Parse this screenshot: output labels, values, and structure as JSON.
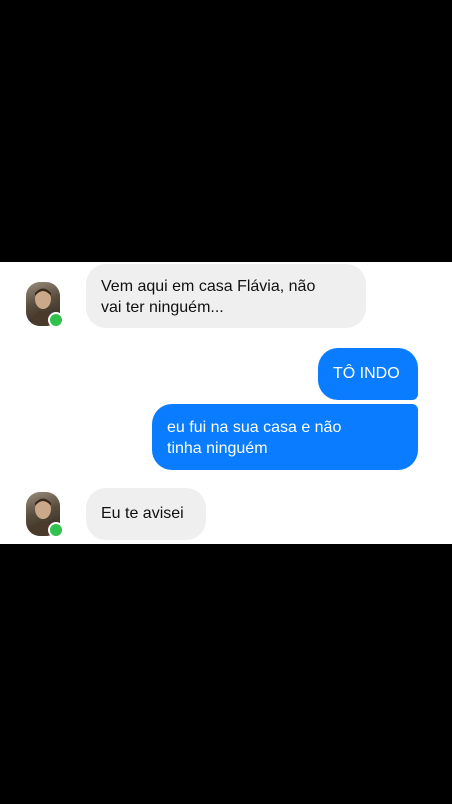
{
  "contact": {
    "avatar_icon": "contact-avatar-photo",
    "status_color": "#31c24d"
  },
  "messages": [
    {
      "direction": "incoming",
      "lines": [
        "Vem aqui em casa Flávia, não",
        "vai ter ninguém..."
      ]
    },
    {
      "direction": "outgoing",
      "lines": [
        "TÔ INDO"
      ]
    },
    {
      "direction": "outgoing",
      "lines": [
        "eu fui na sua casa e não",
        "tinha ninguém"
      ]
    },
    {
      "direction": "incoming",
      "lines": [
        "Eu te avisei"
      ]
    }
  ],
  "colors": {
    "outgoing_bubble": "#0a7cff",
    "incoming_bubble": "#efeff0",
    "background": "#000000"
  }
}
